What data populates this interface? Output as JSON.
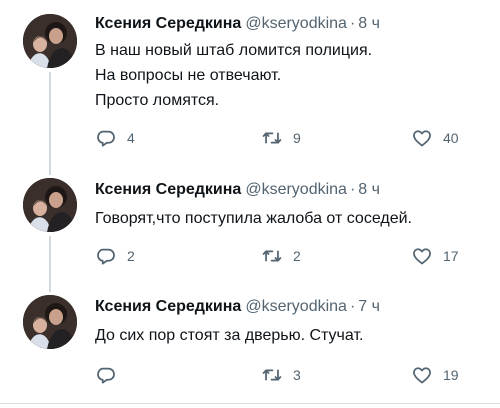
{
  "tweets": [
    {
      "author": "Ксения Середкина",
      "handle": "@kseryodkina",
      "separator": "·",
      "time": "8 ч",
      "text_lines": [
        "В наш новый штаб ломится полиция.",
        "На вопросы не отвечают.",
        "Просто ломятся."
      ],
      "replies": "4",
      "retweets": "9",
      "likes": "40"
    },
    {
      "author": "Ксения Середкина",
      "handle": "@kseryodkina",
      "separator": "·",
      "time": "8 ч",
      "text_lines": [
        "Говорят,что поступила жалоба от соседей."
      ],
      "replies": "2",
      "retweets": "2",
      "likes": "17"
    },
    {
      "author": "Ксения Середкина",
      "handle": "@kseryodkina",
      "separator": "·",
      "time": "7 ч",
      "text_lines": [
        "До сих пор стоят за дверью. Стучат."
      ],
      "replies": "",
      "retweets": "3",
      "likes": "19"
    }
  ],
  "icons": {
    "reply": "reply-icon",
    "retweet": "retweet-icon",
    "like": "heart-icon"
  },
  "colors": {
    "text": "#0f1419",
    "secondary": "#536471",
    "thread_line": "#cfd9de",
    "background": "#ffffff"
  }
}
